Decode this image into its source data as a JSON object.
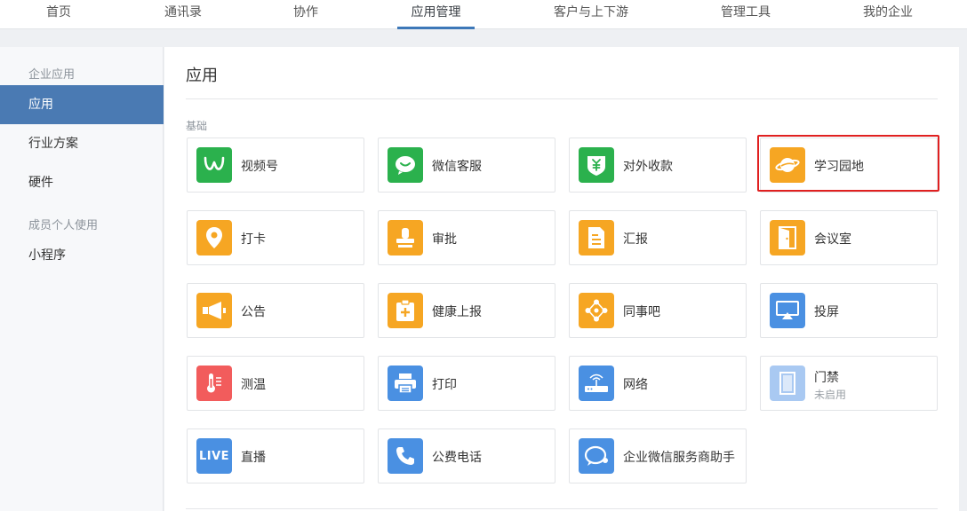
{
  "topnav": {
    "tabs": [
      "首页",
      "通讯录",
      "协作",
      "应用管理",
      "客户与上下游",
      "管理工具",
      "我的企业"
    ],
    "active_index": 3
  },
  "sidebar": {
    "group1": "企业应用",
    "items1": [
      "应用",
      "行业方案",
      "硬件"
    ],
    "group2": "成员个人使用",
    "items2": [
      "小程序"
    ]
  },
  "main": {
    "title": "应用",
    "section": "基础",
    "apps": [
      {
        "name": "视频号",
        "icon": "video-account-icon",
        "color": "#2bb14d"
      },
      {
        "name": "微信客服",
        "icon": "wechat-service-icon",
        "color": "#2bb14d"
      },
      {
        "name": "对外收款",
        "icon": "payment-icon",
        "color": "#2bb14d"
      },
      {
        "name": "学习园地",
        "icon": "planet-icon",
        "color": "#f6a623"
      },
      {
        "name": "打卡",
        "icon": "location-pin-icon",
        "color": "#f6a623"
      },
      {
        "name": "审批",
        "icon": "stamp-icon",
        "color": "#f6a623"
      },
      {
        "name": "汇报",
        "icon": "document-icon",
        "color": "#f6a623"
      },
      {
        "name": "会议室",
        "icon": "door-icon",
        "color": "#f6a623"
      },
      {
        "name": "公告",
        "icon": "megaphone-icon",
        "color": "#f6a623"
      },
      {
        "name": "健康上报",
        "icon": "health-clipboard-icon",
        "color": "#f6a623"
      },
      {
        "name": "同事吧",
        "icon": "colleague-network-icon",
        "color": "#f6a623"
      },
      {
        "name": "投屏",
        "icon": "screencast-icon",
        "color": "#4a90e2"
      },
      {
        "name": "测温",
        "icon": "thermometer-icon",
        "color": "#f25c5c"
      },
      {
        "name": "打印",
        "icon": "printer-icon",
        "color": "#4a90e2"
      },
      {
        "name": "网络",
        "icon": "router-icon",
        "color": "#4a90e2"
      },
      {
        "name": "门禁",
        "icon": "access-door-icon",
        "color": "#a9c9f2",
        "status": "未启用"
      },
      {
        "name": "直播",
        "icon": "live-icon",
        "color": "#4a90e2",
        "icon_text": "LIVE"
      },
      {
        "name": "公费电话",
        "icon": "phone-icon",
        "color": "#4a90e2"
      },
      {
        "name": "企业微信服务商助手",
        "icon": "service-assistant-icon",
        "color": "#4a90e2"
      }
    ]
  }
}
